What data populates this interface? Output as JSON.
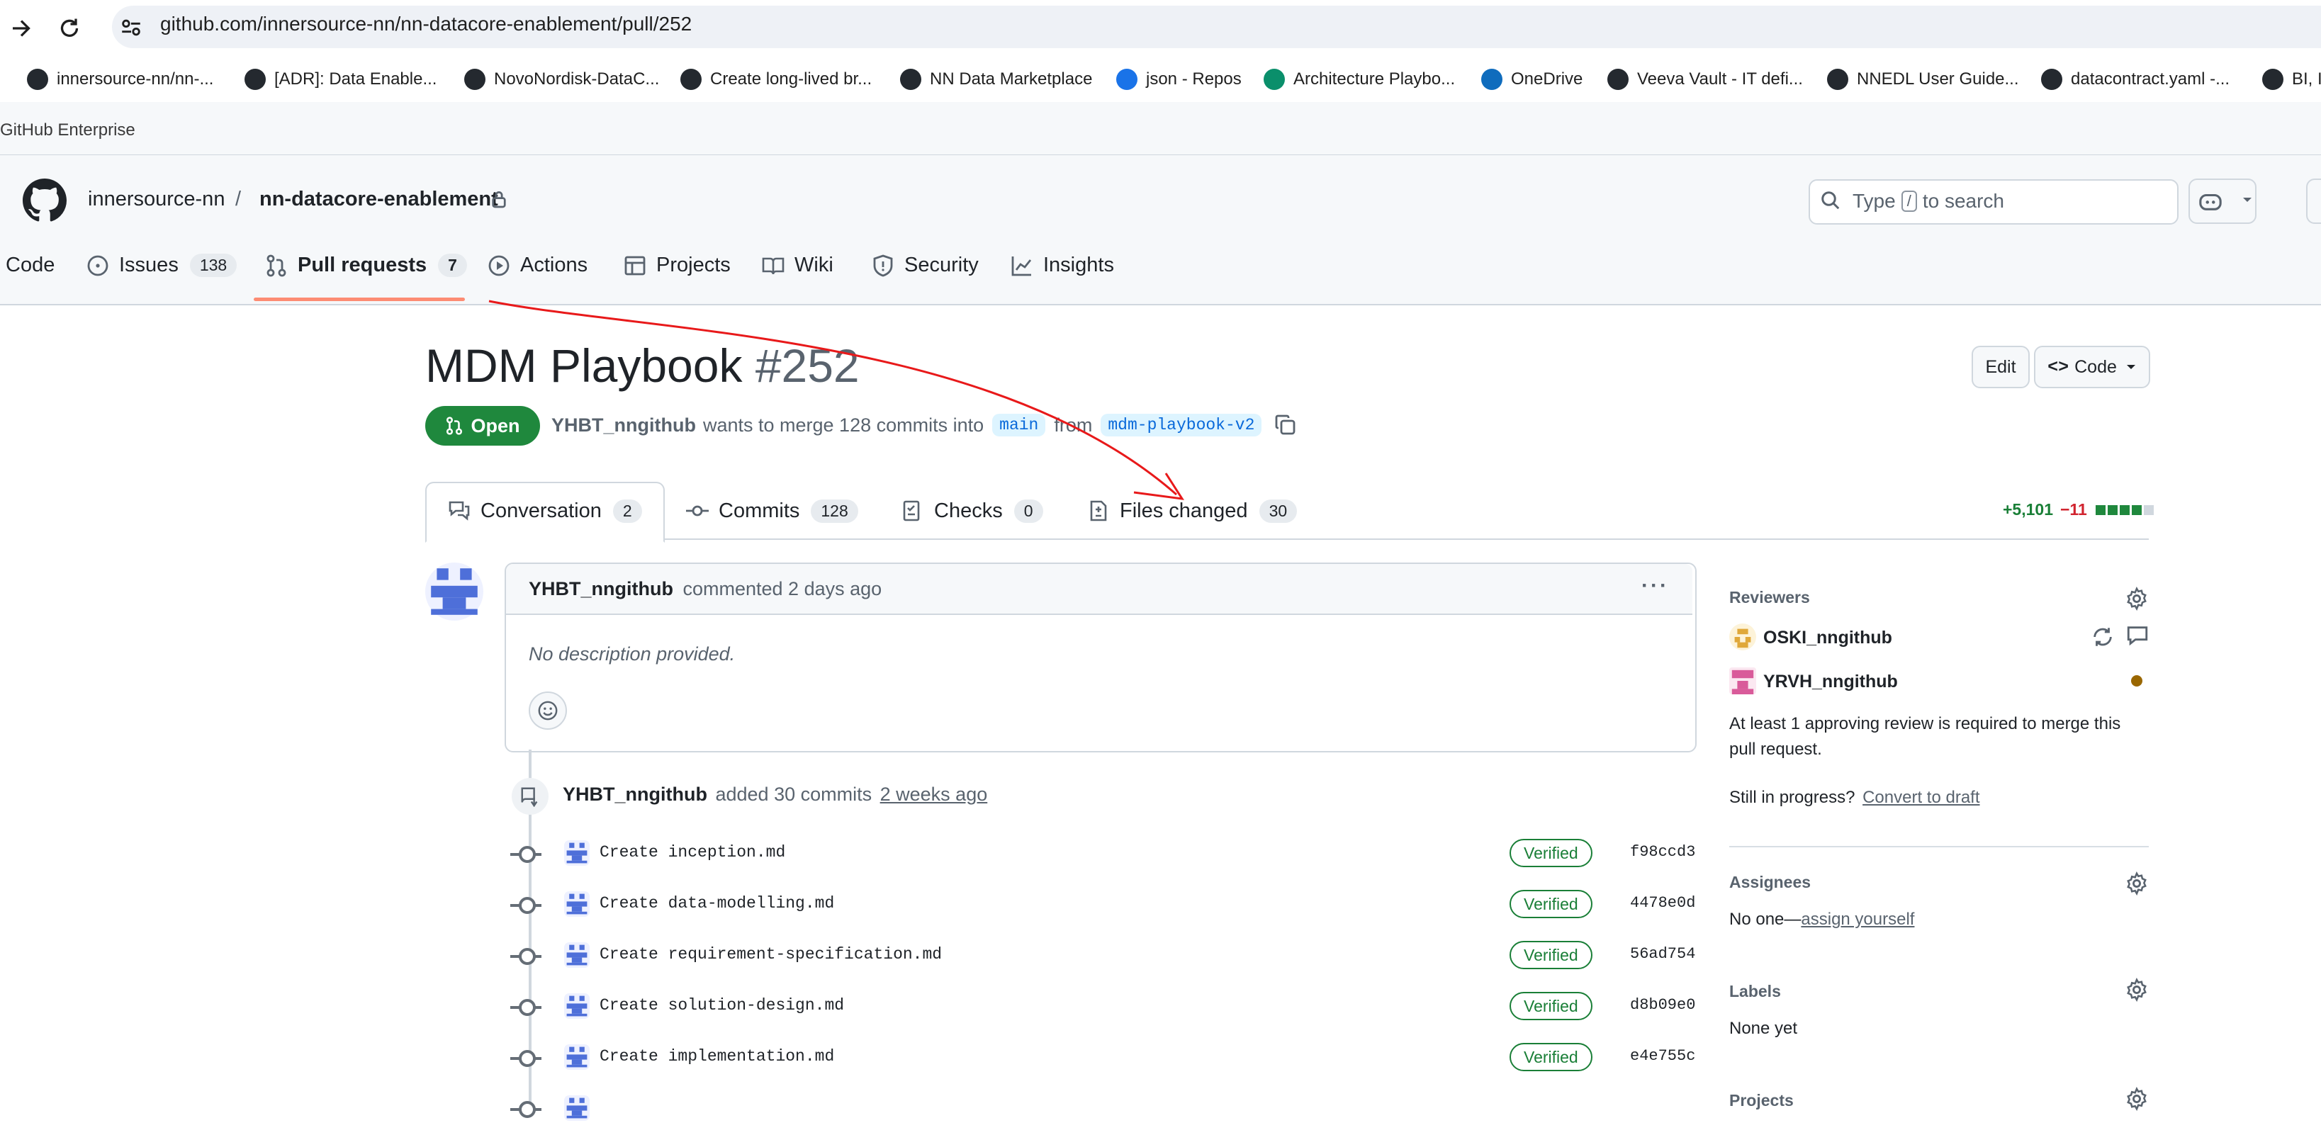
{
  "browser": {
    "url": "github.com/innersource-nn/nn-datacore-enablement/pull/252",
    "bookmarks": [
      "innersource-nn/nn-...",
      "[ADR]: Data Enable...",
      "NovoNordisk-DataC...",
      "Create long-lived br...",
      "NN Data Marketplace",
      "json - Repos",
      "Architecture Playbo...",
      "OneDrive",
      "Veeva Vault - IT defi...",
      "NNEDL User Guide...",
      "datacontract.yaml -...",
      "BI, I"
    ],
    "enterprise_label": "GitHub Enterprise"
  },
  "header": {
    "owner": "innersource-nn",
    "separator": "/",
    "repo": "nn-datacore-enablement",
    "search_text_before": "Type",
    "search_key": "/",
    "search_text_after": "to search"
  },
  "repo_nav": [
    {
      "label": "Code",
      "count": null,
      "icon": "code-icon"
    },
    {
      "label": "Issues",
      "count": "138",
      "icon": "issue-opened-icon"
    },
    {
      "label": "Pull requests",
      "count": "7",
      "icon": "git-pull-request-icon"
    },
    {
      "label": "Actions",
      "count": null,
      "icon": "play-icon"
    },
    {
      "label": "Projects",
      "count": null,
      "icon": "table-icon"
    },
    {
      "label": "Wiki",
      "count": null,
      "icon": "book-icon"
    },
    {
      "label": "Security",
      "count": null,
      "icon": "shield-icon"
    },
    {
      "label": "Insights",
      "count": null,
      "icon": "graph-icon"
    }
  ],
  "pr": {
    "title": "MDM Playbook",
    "number": "#252",
    "edit_label": "Edit",
    "code_label": "Code",
    "state": "Open",
    "author": "YHBT_nngithub",
    "merge_text": "wants to merge 128 commits into",
    "base": "main",
    "from_text": "from",
    "head": "mdm-playbook-v2",
    "tabs": [
      {
        "label": "Conversation",
        "count": "2",
        "icon": "comment-discussion-icon"
      },
      {
        "label": "Commits",
        "count": "128",
        "icon": "git-commit-icon"
      },
      {
        "label": "Checks",
        "count": "0",
        "icon": "checklist-icon"
      },
      {
        "label": "Files changed",
        "count": "30",
        "icon": "file-diff-icon"
      }
    ],
    "additions": "+5,101",
    "deletions": "−11"
  },
  "comment": {
    "author": "YHBT_nngithub",
    "action": "commented 2 days ago",
    "body": "No description provided."
  },
  "commits_event": {
    "author": "YHBT_nngithub",
    "text": "added 30 commits",
    "time": "2 weeks ago",
    "commits": [
      {
        "msg": "Create inception.md",
        "badge": "Verified",
        "sha": "f98ccd3"
      },
      {
        "msg": "Create data-modelling.md",
        "badge": "Verified",
        "sha": "4478e0d"
      },
      {
        "msg": "Create requirement-specification.md",
        "badge": "Verified",
        "sha": "56ad754"
      },
      {
        "msg": "Create solution-design.md",
        "badge": "Verified",
        "sha": "d8b09e0"
      },
      {
        "msg": "Create implementation.md",
        "badge": "Verified",
        "sha": "e4e755c"
      }
    ]
  },
  "sidebar": {
    "reviewers_title": "Reviewers",
    "reviewers": [
      "OSKI_nngithub",
      "YRVH_nngithub"
    ],
    "review_note": "At least 1 approving review is required to merge this pull request.",
    "in_progress": "Still in progress?",
    "convert_link": "Convert to draft",
    "assignees_title": "Assignees",
    "assignees_none": "No one—",
    "assign_link": "assign yourself",
    "labels_title": "Labels",
    "labels_none": "None yet",
    "projects_title": "Projects"
  },
  "colors": {
    "accent_open": "#1f883d",
    "link_blue": "#0969da",
    "annotation_arrow": "#e8191a",
    "nav_underline": "#fd8c73"
  }
}
